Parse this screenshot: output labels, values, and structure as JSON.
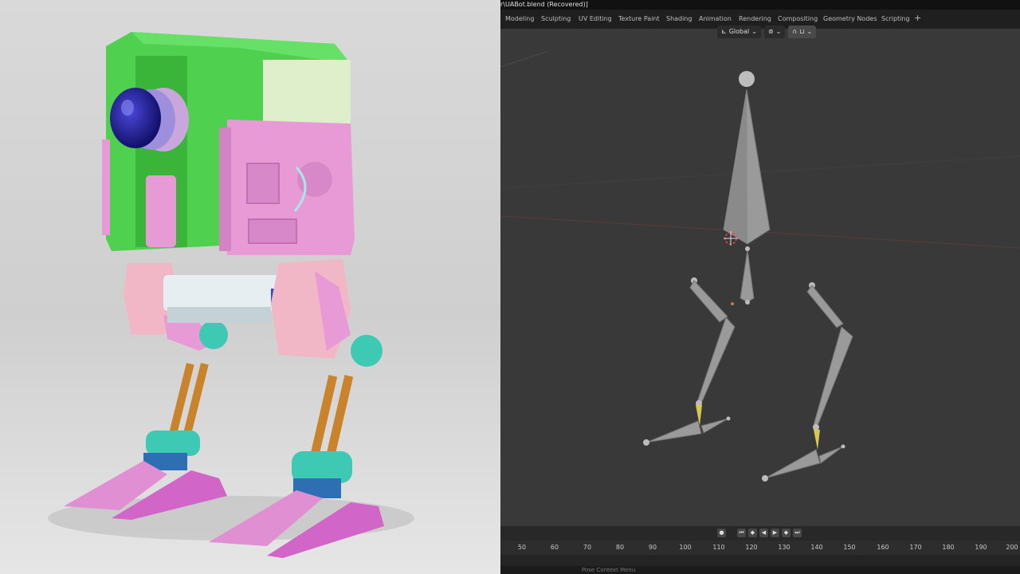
{
  "window": {
    "title": "r\\UABot.blend (Recovered)]"
  },
  "workspaces": [
    {
      "label": "Modeling"
    },
    {
      "label": "Sculpting"
    },
    {
      "label": "UV Editing"
    },
    {
      "label": "Texture Paint"
    },
    {
      "label": "Shading"
    },
    {
      "label": "Animation"
    },
    {
      "label": "Rendering"
    },
    {
      "label": "Compositing"
    },
    {
      "label": "Geometry Nodes"
    },
    {
      "label": "Scripting"
    }
  ],
  "add_workspace_label": "+",
  "viewport_header": {
    "transform_orientation": "Global",
    "pivot_icon": "pivot-icon",
    "snap_icon": "magnet-icon",
    "proportional_icon": "proportional-edit-icon"
  },
  "playback_icons": [
    "record-icon",
    "jump-start-icon",
    "prev-keyframe-icon",
    "play-reverse-icon",
    "play-icon",
    "next-keyframe-icon",
    "jump-end-icon"
  ],
  "timeline": {
    "ticks": [
      "50",
      "60",
      "70",
      "80",
      "90",
      "100",
      "110",
      "120",
      "130",
      "140",
      "150",
      "160",
      "170",
      "180",
      "190",
      "200"
    ]
  },
  "status_bar": {
    "hint": "Pose Context Menu"
  },
  "colors": {
    "viewport_bg": "#393939",
    "robot_body_green": "#4fd14f",
    "robot_panel_pink": "#e89ad6",
    "robot_foot_magenta": "#d266c8",
    "robot_joint_teal": "#3ec9b4",
    "robot_lens_blue": "#23208f",
    "bone_gray": "#9a9a9a"
  }
}
